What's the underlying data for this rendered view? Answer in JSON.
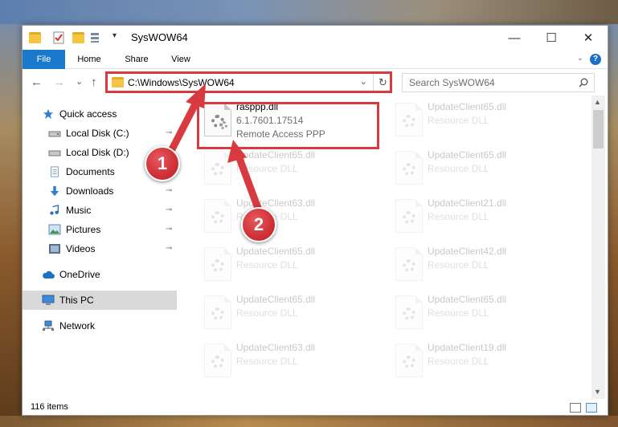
{
  "window": {
    "title": "SysWOW64",
    "minimize_glyph": "—",
    "maximize_glyph": "☐",
    "close_glyph": "✕"
  },
  "ribbon": {
    "tabs": [
      "File",
      "Home",
      "Share",
      "View"
    ],
    "help_glyph": "?",
    "collapse_glyph": "⌄"
  },
  "nav": {
    "back_glyph": "←",
    "forward_glyph": "→",
    "recent_glyph": "⌄",
    "up_glyph": "↑",
    "address": "C:\\Windows\\SysWOW64",
    "address_dropdown_glyph": "⌄",
    "refresh_glyph": "↻",
    "search_placeholder": "Search SysWOW64"
  },
  "sidebar": {
    "items": [
      {
        "label": "Quick access",
        "icon": "star-icon"
      },
      {
        "label": "Local Disk (C:)",
        "icon": "drive-icon",
        "pinned": true
      },
      {
        "label": "Local Disk (D:)",
        "icon": "drive-icon",
        "pinned": true
      },
      {
        "label": "Documents",
        "icon": "documents-icon",
        "pinned": true
      },
      {
        "label": "Downloads",
        "icon": "downloads-icon",
        "pinned": true
      },
      {
        "label": "Music",
        "icon": "music-icon",
        "pinned": true
      },
      {
        "label": "Pictures",
        "icon": "pictures-icon",
        "pinned": true
      },
      {
        "label": "Videos",
        "icon": "videos-icon",
        "pinned": true
      },
      {
        "label": "OneDrive",
        "icon": "cloud-icon"
      },
      {
        "label": "This PC",
        "icon": "computer-icon",
        "selected": true
      },
      {
        "label": "Network",
        "icon": "network-icon"
      }
    ],
    "pin_glyph": "📌"
  },
  "files": [
    {
      "name": "rasppp.dll",
      "line1": "6.1.7601.17514",
      "line2": "Remote Access PPP",
      "highlighted": true
    },
    {
      "name": "UpdateClient65.dll",
      "line1": "Resource DLL"
    },
    {
      "name": "UpdateClient65.dll",
      "line1": "Resource DLL"
    },
    {
      "name": "UpdateClient65.dll",
      "line1": "Resource DLL"
    },
    {
      "name": "UpdateClient63.dll",
      "line1": "Resource DLL"
    },
    {
      "name": "UpdateClient21.dll",
      "line1": "Resource DLL"
    },
    {
      "name": "UpdateClient65.dll",
      "line1": "Resource DLL"
    },
    {
      "name": "UpdateClient42.dll",
      "line1": "Resource DLL"
    },
    {
      "name": "UpdateClient65.dll",
      "line1": "Resource DLL"
    },
    {
      "name": "UpdateClient65.dll",
      "line1": "Resource DLL"
    },
    {
      "name": "UpdateClient63.dll",
      "line1": "Resource DLL"
    },
    {
      "name": "UpdateClient19.dll",
      "line1": "Resource DLL"
    }
  ],
  "status": {
    "item_count": "116 items"
  },
  "annotations": {
    "step1": "1",
    "step2": "2",
    "highlight_color": "#d93a3f"
  }
}
